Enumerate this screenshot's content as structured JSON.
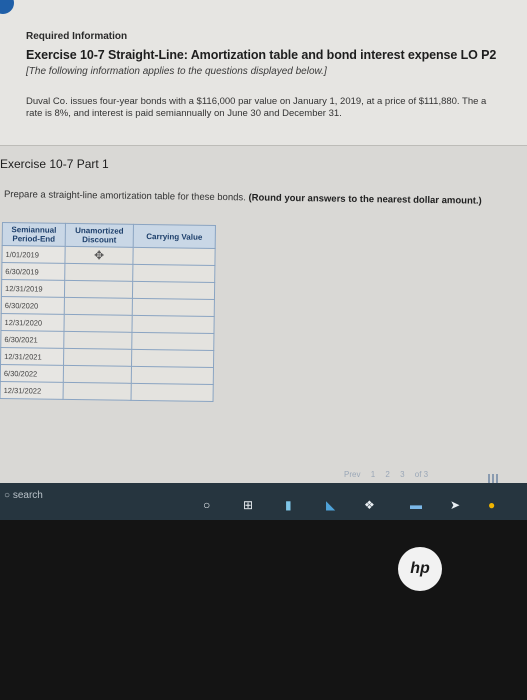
{
  "info": {
    "heading": "Required Information",
    "exercise_title": "Exercise 10-7 Straight-Line: Amortization table and bond interest expense LO P2",
    "note": "[The following information applies to the questions displayed below.]",
    "desc_line1": "Duval Co. issues four-year bonds with a $116,000 par value on January 1, 2019, at a price of $111,880. The a",
    "desc_line2": "rate is 8%, and interest is paid semiannually on June 30 and December 31."
  },
  "part": {
    "title": "Exercise 10-7 Part 1",
    "prompt": "Prepare a straight-line amortization table for these bonds.",
    "prompt_bold": "(Round your answers to the nearest dollar amount.)"
  },
  "table": {
    "headers": [
      "Semiannual Period-End",
      "Unamortized Discount",
      "Carrying Value"
    ],
    "rows": [
      "1/01/2019",
      "6/30/2019",
      "12/31/2019",
      "6/30/2020",
      "12/31/2020",
      "6/30/2021",
      "12/31/2021",
      "6/30/2022",
      "12/31/2022"
    ]
  },
  "pager": {
    "prev": "Prev",
    "pages": [
      "1",
      "2",
      "3"
    ],
    "of_label": "of 3"
  },
  "taskbar": {
    "search": "search"
  },
  "icons": [
    "cursor-icon",
    "grid-icon",
    "cortana-icon",
    "task-view-icon",
    "dropbox-icon",
    "hp-logo-icon"
  ],
  "colors": {
    "header_bg": "#c9d7e6",
    "header_text": "#1d3f6b",
    "taskbar": "#26353f"
  }
}
